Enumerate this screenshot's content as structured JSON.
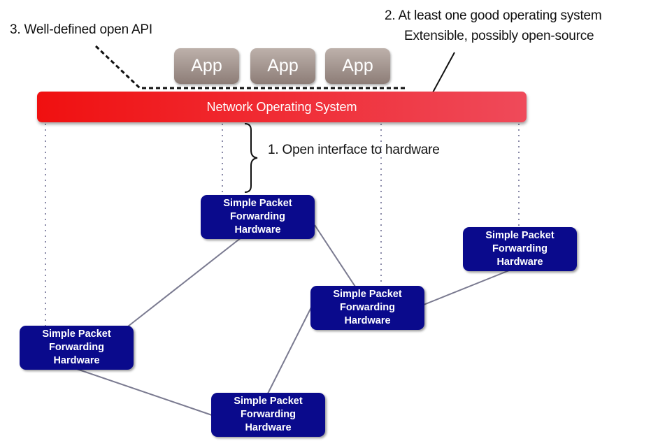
{
  "annotations": {
    "api": "3. Well-defined open API",
    "os_line1": "2. At least one good operating system",
    "os_line2": "Extensible, possibly open-source",
    "hardware_interface": "1. Open interface to hardware"
  },
  "apps": [
    "App",
    "App",
    "App"
  ],
  "nos_label": "Network Operating  System",
  "hardware_nodes": [
    {
      "line1": "Simple Packet",
      "line2": "Forwarding",
      "line3": "Hardware"
    },
    {
      "line1": "Simple Packet",
      "line2": "Forwarding",
      "line3": "Hardware"
    },
    {
      "line1": "Simple Packet",
      "line2": "Forwarding",
      "line3": "Hardware"
    },
    {
      "line1": "Simple Packet",
      "line2": "Forwarding",
      "line3": "Hardware"
    },
    {
      "line1": "Simple Packet",
      "line2": "Forwarding",
      "line3": "Hardware"
    }
  ],
  "colors": {
    "nos": "#f01010",
    "hardware": "#0a0a8c",
    "app": "#a89893",
    "links": "#7a7a90"
  }
}
